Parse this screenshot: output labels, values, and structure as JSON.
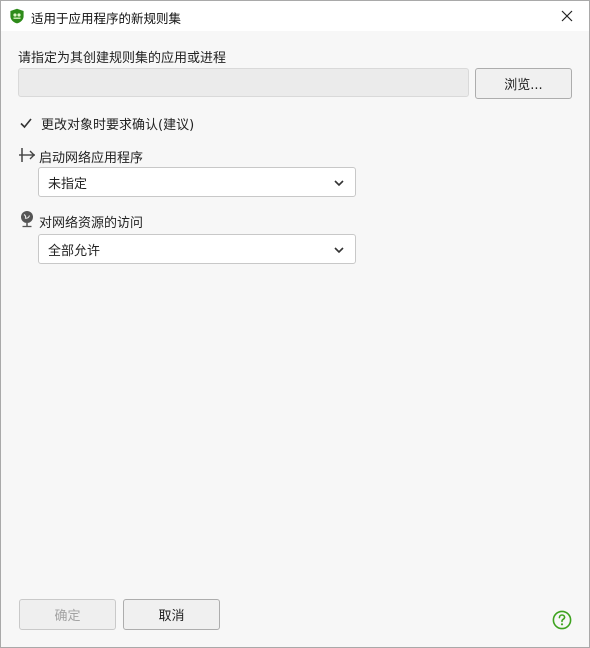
{
  "window": {
    "title": "适用于应用程序的新规则集"
  },
  "app_selector": {
    "label": "请指定为其创建规则集的应用或进程",
    "path_value": "",
    "browse_label": "浏览..."
  },
  "confirm_checkbox": {
    "label": "更改对象时要求确认(建议)",
    "checked": true
  },
  "network_launch": {
    "label": "启动网络应用程序",
    "selected": "未指定"
  },
  "network_access": {
    "label": "对网络资源的访问",
    "selected": "全部允许"
  },
  "footer": {
    "ok_label": "确定",
    "cancel_label": "取消"
  },
  "colors": {
    "accent_green": "#3ea31f",
    "brand_green": "#2e8b1a"
  },
  "icons": {
    "app": "shield-bug-icon",
    "close": "close-icon",
    "check": "checkmark-icon",
    "launch": "network-launch-icon",
    "access": "globe-pin-icon",
    "chevron": "chevron-down-icon",
    "help": "help-icon"
  }
}
